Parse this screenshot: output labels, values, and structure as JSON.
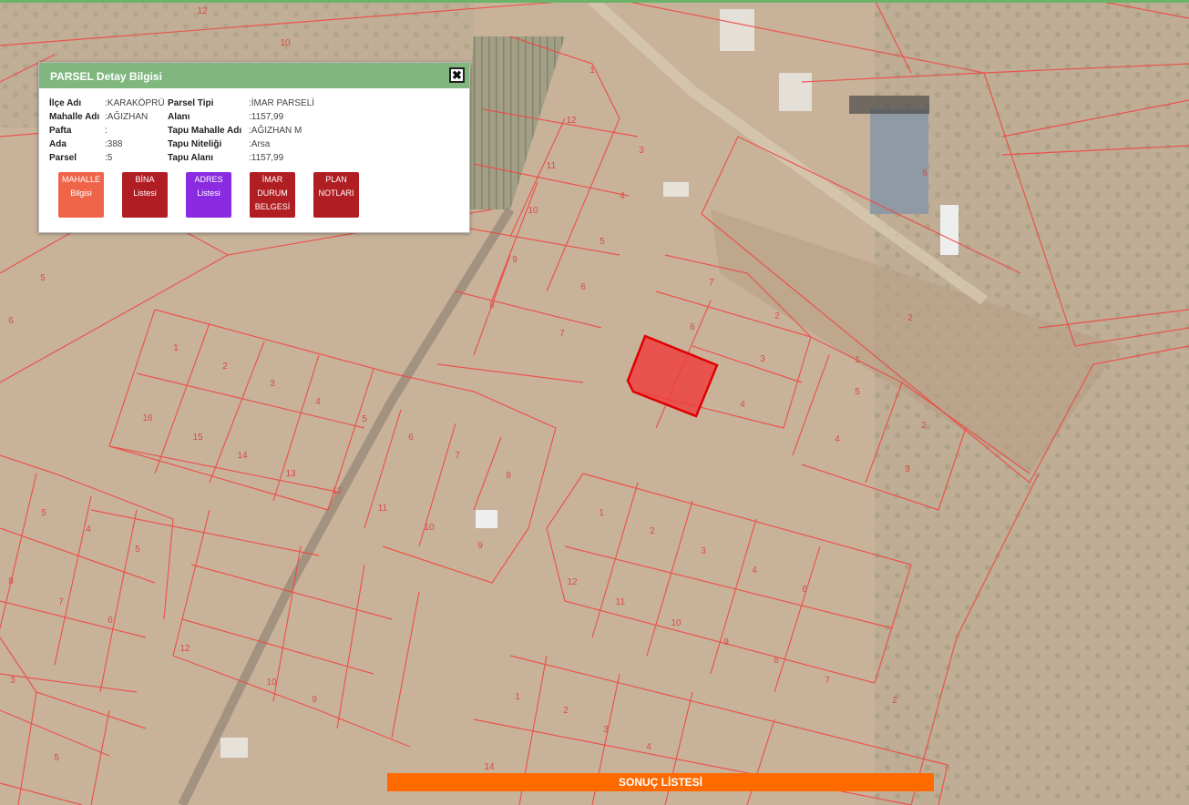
{
  "popup": {
    "title": "PARSEL Detay Bilgisi",
    "close_symbol": "✖",
    "fields_left": [
      {
        "label": "İlçe Adı",
        "value": ":KARAKÖPRÜ"
      },
      {
        "label": "Mahalle Adı",
        "value": ":AĞIZHAN"
      },
      {
        "label": "Pafta",
        "value": ":"
      },
      {
        "label": "Ada",
        "value": ":388"
      },
      {
        "label": "Parsel",
        "value": ":5"
      }
    ],
    "fields_right": [
      {
        "label": "Parsel Tipi",
        "value": ":İMAR PARSELİ"
      },
      {
        "label": "Alanı",
        "value": ":1157,99"
      },
      {
        "label": "Tapu Mahalle Adı",
        "value": ":AĞIZHAN M"
      },
      {
        "label": "Tapu Niteliği",
        "value": ":Arsa"
      },
      {
        "label": "Tapu Alanı",
        "value": ":1157,99"
      }
    ],
    "buttons": [
      {
        "label": "MAHALLE\nBilgisi",
        "color": "#f0654a"
      },
      {
        "label": "BİNA\nListesi",
        "color": "#b01e24"
      },
      {
        "label": "ADRES\nListesi",
        "color": "#8a2be2"
      },
      {
        "label": "İMAR\nDURUM\nBELGESİ",
        "color": "#b01e24"
      },
      {
        "label": "PLAN\nNOTLARI",
        "color": "#b01e24"
      }
    ]
  },
  "result_bar": {
    "label": "SONUÇ LİSTESİ"
  },
  "map": {
    "parcel_numbers": [
      "1",
      "2",
      "3",
      "4",
      "5",
      "6",
      "7",
      "8",
      "9",
      "10",
      "11",
      "12",
      "13",
      "14",
      "15",
      "16"
    ],
    "colors": {
      "boundary": "#ee4a46",
      "selected_fill": "#f03b3b",
      "selected_stroke": "#e00000",
      "ground": "#c9b49c",
      "header_green": "#7fb77e",
      "result_orange": "#ff6a00"
    }
  }
}
